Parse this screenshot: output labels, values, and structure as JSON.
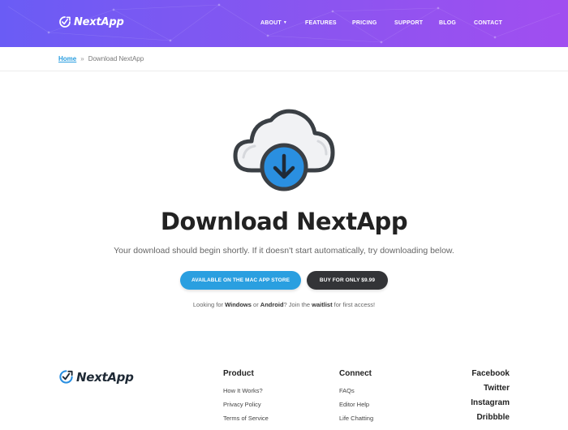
{
  "brand": {
    "name": "NextApp"
  },
  "colors": {
    "header_gradient_start": "#6a5cf5",
    "header_gradient_end": "#a14ef0",
    "accent_blue": "#2a9fe0",
    "dark_button": "#333437",
    "cloud_fill": "#f1f2f4",
    "cloud_outline": "#3a3f44"
  },
  "nav": {
    "items": [
      {
        "label": "ABOUT",
        "has_dropdown": true,
        "dropdown_icon": "caret-down-icon"
      },
      {
        "label": "FEATURES"
      },
      {
        "label": "PRICING"
      },
      {
        "label": "SUPPORT"
      },
      {
        "label": "BLOG"
      },
      {
        "label": "CONTACT"
      }
    ]
  },
  "breadcrumb": {
    "home": "Home",
    "separator": "»",
    "current": "Download NextApp"
  },
  "hero": {
    "icon": "cloud-download-icon",
    "title": "Download NextApp",
    "subtitle": "Your download should begin shortly. If it doesn't start automatically, try downloading below."
  },
  "buttons": {
    "mac_store": "AVAILABLE ON THE MAC APP STORE",
    "buy": "BUY FOR ONLY $9.99"
  },
  "note": {
    "prefix": "Looking for ",
    "windows": "Windows",
    "or": " or ",
    "android": "Android",
    "middle": "? Join the ",
    "waitlist": "waitlist",
    "suffix": " for first access!"
  },
  "footer": {
    "product": {
      "heading": "Product",
      "links": [
        "How It Works?",
        "Privacy Policy",
        "Terms of Service"
      ]
    },
    "connect": {
      "heading": "Connect",
      "links": [
        "FAQs",
        "Editor Help",
        "Life Chatting"
      ]
    },
    "social": [
      "Facebook",
      "Twitter",
      "Instagram",
      "Dribbble"
    ]
  }
}
